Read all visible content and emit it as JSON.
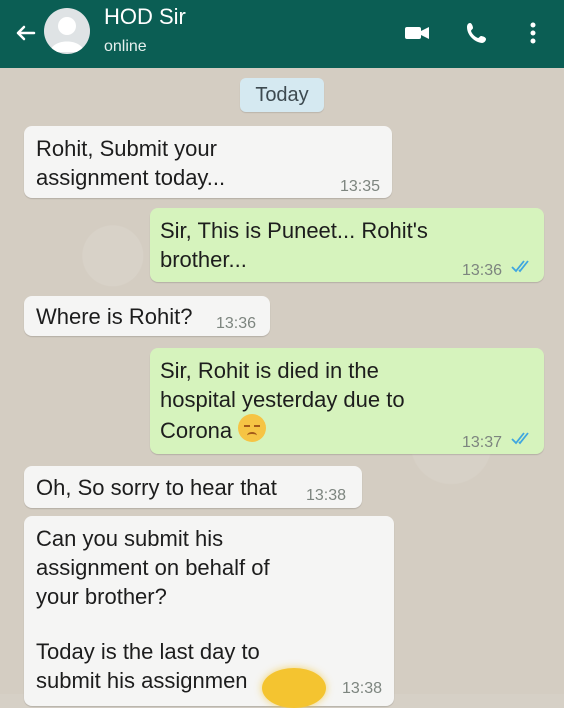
{
  "header": {
    "contact_name": "HOD Sir",
    "status": "online",
    "color": "#0b5e54"
  },
  "chat": {
    "date_label": "Today",
    "messages": [
      {
        "direction": "in",
        "text_lines": [
          "Rohit, Submit your",
          "assignment today..."
        ],
        "time": "13:35"
      },
      {
        "direction": "out",
        "text_lines": [
          "Sir, This is Puneet... Rohit's",
          "brother..."
        ],
        "time": "13:36",
        "read": true
      },
      {
        "direction": "in",
        "text_lines": [
          "Where is Rohit?"
        ],
        "time": "13:36"
      },
      {
        "direction": "out",
        "text_lines": [
          "Sir, Rohit is died in the",
          "hospital yesterday due to",
          "Corona"
        ],
        "time": "13:37",
        "emoji": "disappointed-face",
        "read": true
      },
      {
        "direction": "in",
        "text_lines": [
          "Oh, So sorry to hear that"
        ],
        "time": "13:38"
      },
      {
        "direction": "in",
        "text_lines": [
          "Can you submit his",
          "assignment on behalf of",
          "your brother?",
          "",
          "Today is the last day to",
          "submit his assignmen"
        ],
        "time": "13:38"
      }
    ]
  },
  "icons": {
    "back": "arrow-left-icon",
    "video": "video-camera-icon",
    "call": "phone-icon",
    "menu": "more-vertical-icon"
  }
}
